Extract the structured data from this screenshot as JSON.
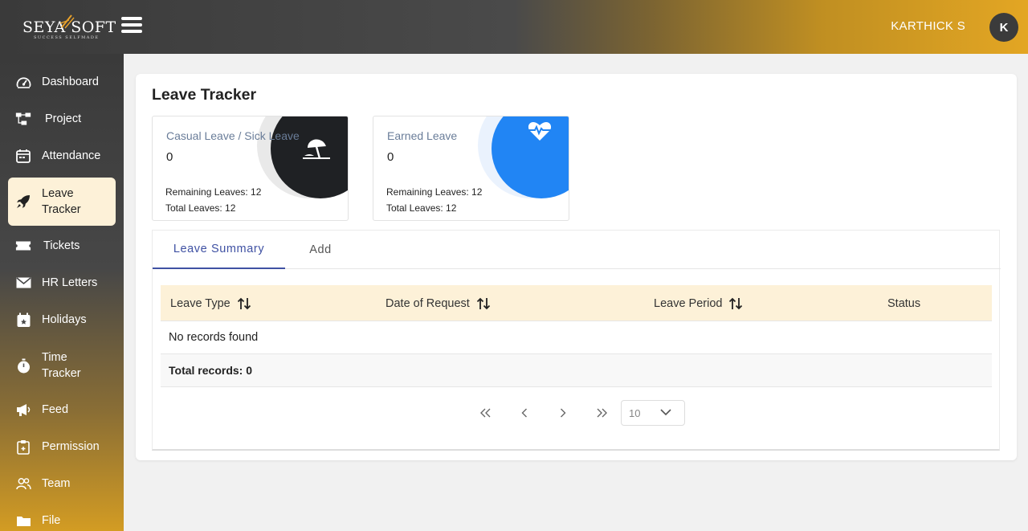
{
  "header": {
    "logo_text": "SEYA SOFT",
    "logo_tagline": "SUCCESS SELFMADE",
    "user_name": "KARTHICK S",
    "avatar_initial": "K"
  },
  "sidebar": {
    "items": [
      {
        "label": "Dashboard",
        "icon": "gauge-icon"
      },
      {
        "label": "Project",
        "icon": "sitemap-icon"
      },
      {
        "label": "Attendance",
        "icon": "calendar-icon"
      },
      {
        "label": "Leave Tracker",
        "icon": "rocket-icon",
        "active": true
      },
      {
        "label": "Tickets",
        "icon": "ticket-icon"
      },
      {
        "label": "HR Letters",
        "icon": "envelope-icon"
      },
      {
        "label": "Holidays",
        "icon": "calendar-star-icon"
      },
      {
        "label": "Time Tracker",
        "icon": "stopwatch-icon"
      },
      {
        "label": "Feed",
        "icon": "megaphone-icon"
      },
      {
        "label": "Permission",
        "icon": "clipboard-icon"
      },
      {
        "label": "Team",
        "icon": "users-icon"
      },
      {
        "label": "File",
        "icon": "folder-icon"
      }
    ]
  },
  "main": {
    "title": "Leave Tracker",
    "cards": [
      {
        "name": "Casual Leave / Sick Leave",
        "count": "0",
        "remaining": "Remaining Leaves: 12",
        "total": "Total Leaves: 12",
        "icon": "umbrella-beach-icon",
        "color": "#1f2124"
      },
      {
        "name": "Earned Leave",
        "count": "0",
        "remaining": "Remaining Leaves: 12",
        "total": "Total Leaves: 12",
        "icon": "heartbeat-icon",
        "color": "#2185f4"
      }
    ],
    "tabs": [
      {
        "label": "Leave Summary",
        "active": true
      },
      {
        "label": "Add",
        "active": false
      }
    ],
    "table": {
      "columns": [
        "Leave Type",
        "Date of Request",
        "Leave Period",
        "Status"
      ],
      "empty_message": "No records found",
      "total_records": "Total records: 0"
    },
    "paginator": {
      "rows_per_page": "10"
    }
  }
}
